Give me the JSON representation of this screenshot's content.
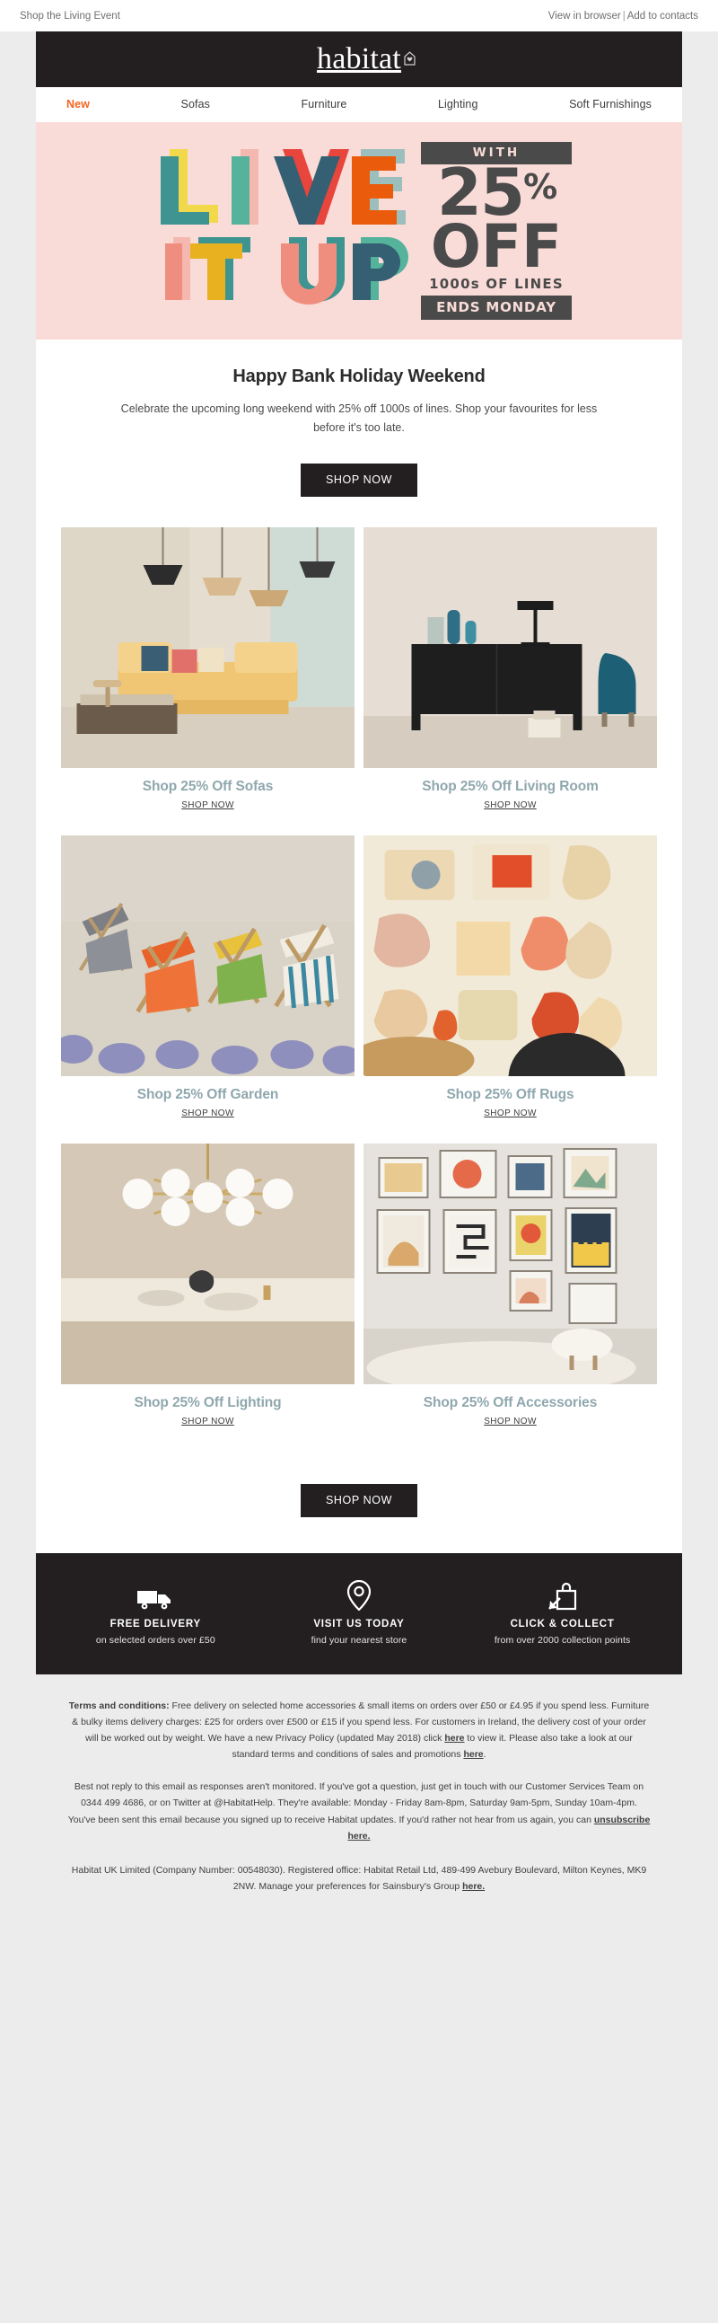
{
  "preheader": {
    "left": "Shop the Living Event",
    "view_in_browser": "View in browser",
    "separator": "|",
    "add_to_contacts": "Add to contacts"
  },
  "brand": {
    "logo_text": "habitat",
    "logo_mark": "house-heart-icon",
    "bar_color": "#231f20"
  },
  "nav": {
    "items": [
      {
        "label": "New",
        "active": true
      },
      {
        "label": "Sofas",
        "active": false
      },
      {
        "label": "Furniture",
        "active": false
      },
      {
        "label": "Lighting",
        "active": false
      },
      {
        "label": "Soft Furnishings",
        "active": false
      }
    ],
    "active_color": "#f26522"
  },
  "hero": {
    "background": "#f9dcd8",
    "headline_line1": "LIVE",
    "headline_line2": "IT UP",
    "promo": {
      "with": "WITH",
      "percent_number": "25",
      "percent_symbol": "%",
      "off": "OFF",
      "lines": "1000s OF LINES",
      "ends": "ENDS MONDAY",
      "dark": "#4a4a4a"
    },
    "letter_colors": {
      "teal": "#3d9490",
      "yellow": "#f2d84b",
      "mint": "#55b39c",
      "pink": "#f5b8b0",
      "navy": "#355f72",
      "red": "#e8453c",
      "orange": "#ea5b0c",
      "sage": "#9cbfbd",
      "coral": "#ef8e7e",
      "gold": "#e8b11f",
      "rose": "#f08a80"
    }
  },
  "intro": {
    "heading": "Happy Bank Holiday Weekend",
    "body": "Celebrate the upcoming long weekend with 25% off 1000s of lines. Shop your favourites for less before it's too late."
  },
  "cta_top": {
    "label": "SHOP NOW"
  },
  "cta_bottom": {
    "label": "SHOP NOW"
  },
  "products": [
    {
      "title": "Shop 25% Off Sofas",
      "shop_now": "SHOP NOW",
      "image": "yellow-sofa-living-room-with-pendant-lamps"
    },
    {
      "title": "Shop 25% Off Living Room",
      "shop_now": "SHOP NOW",
      "image": "black-sideboard-with-table-lamp-and-blue-armchair"
    },
    {
      "title": "Shop 25% Off Garden",
      "shop_now": "SHOP NOW",
      "image": "colourful-deck-chairs-on-patio"
    },
    {
      "title": "Shop 25% Off Rugs",
      "shop_now": "SHOP NOW",
      "image": "abstract-patterned-rug-with-vases"
    },
    {
      "title": "Shop 25% Off Lighting",
      "shop_now": "SHOP NOW",
      "image": "brass-globe-chandelier-over-dining-table"
    },
    {
      "title": "Shop 25% Off Accessories",
      "shop_now": "SHOP NOW",
      "image": "gallery-wall-of-framed-prints"
    }
  ],
  "benefits": [
    {
      "icon": "delivery-truck-icon",
      "title": "FREE DELIVERY",
      "subtitle": "on selected orders over £50"
    },
    {
      "icon": "map-pin-icon",
      "title": "VISIT US TODAY",
      "subtitle": "find your nearest store"
    },
    {
      "icon": "click-and-collect-bag-icon",
      "title": "CLICK & COLLECT",
      "subtitle": "from over 2000 collection points"
    }
  ],
  "legal": {
    "terms_label": "Terms and conditions:",
    "terms_part1": " Free delivery on selected home accessories & small items on orders over £50 or £4.95 if you spend less. Furniture & bulky items delivery charges: £25 for orders over £500 or £15 if you spend less. For customers in Ireland, the delivery cost of your order will be worked out by weight. We have a new Privacy Policy (updated May 2018) click ",
    "terms_link1": "here",
    "terms_part2": " to view it. Please also take a look at our standard terms and conditions of sales and promotions ",
    "terms_link2": "here",
    "terms_part3": ".",
    "contact_part1": "Best not reply to this email as responses aren't monitored. If you've got a question, just get in touch with our Customer Services Team on 0344 499 4686, or on Twitter at @HabitatHelp. They're available: Monday - Friday 8am-8pm, Saturday 9am-5pm, Sunday 10am-4pm. You've been sent this email because you signed up to receive Habitat updates. If you'd rather not hear from us again, you can ",
    "contact_link": "unsubscribe here.",
    "reg_part1": "Habitat UK Limited (Company Number: 00548030). Registered office: Habitat Retail Ltd, 489-499 Avebury Boulevard, Milton Keynes, MK9 2NW. Manage your preferences for Sainsbury's Group ",
    "reg_link": "here."
  }
}
